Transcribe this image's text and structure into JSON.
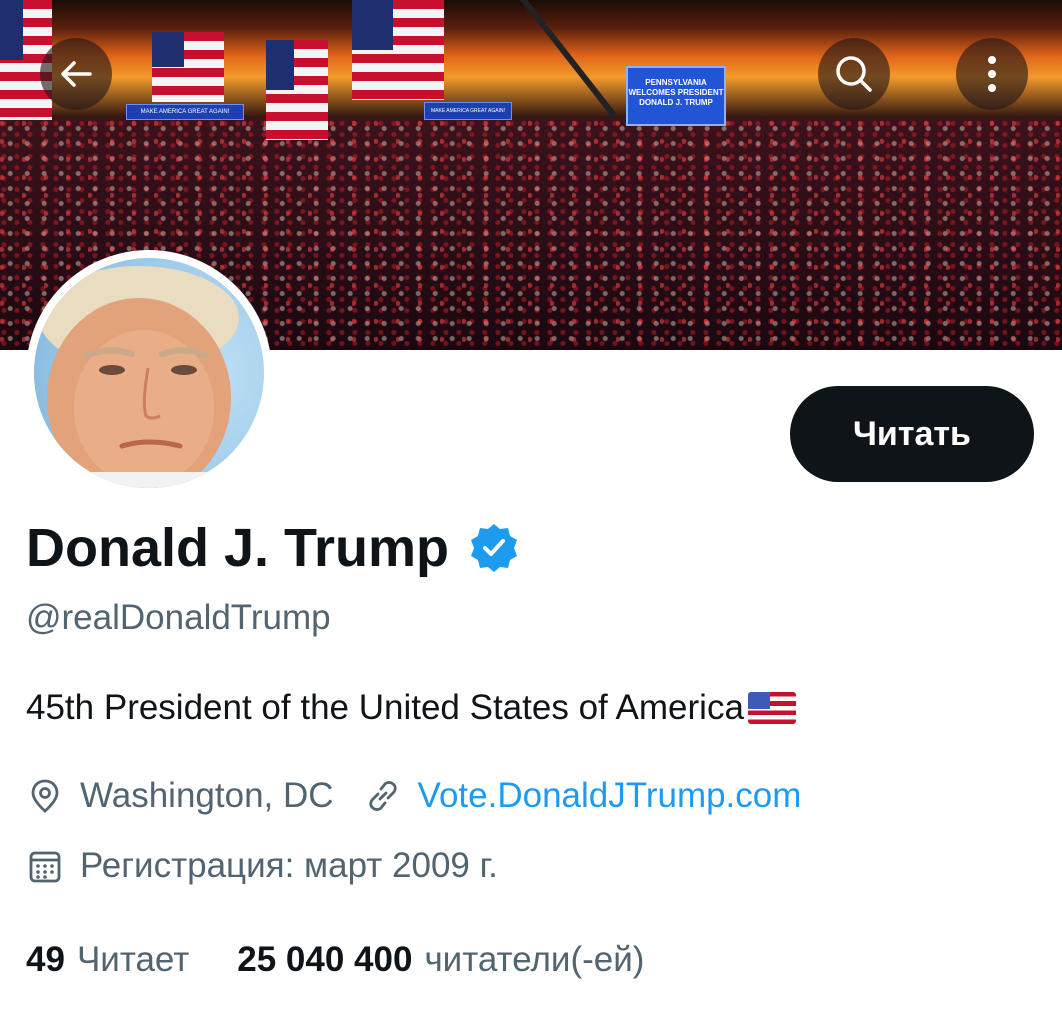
{
  "header": {
    "back_icon": "arrow-left-icon",
    "search_icon": "search-icon",
    "more_icon": "more-vertical-icon"
  },
  "profile": {
    "name": "Donald J. Trump",
    "handle": "@realDonaldTrump",
    "bio": "45th President of the United States of America",
    "bio_emoji": "us-flag-emoji",
    "location": "Washington, DC",
    "website": "Vote.DonaldJTrump.com",
    "joined": "Регистрация: март 2009 г.",
    "follow_label": "Читать",
    "verified_color": "#1d9bf0"
  },
  "stats": {
    "following_count": "49",
    "following_label": "Читает",
    "followers_count": "25 040 400",
    "followers_label": "читатели(-ей)"
  },
  "banner_text": {
    "jumbotron": "PENNSYLVANIA WELCOMES PRESIDENT DONALD J. TRUMP",
    "sign_left": "MAKE AMERICA GREAT AGAIN!",
    "sign_center": "MAKE AMERICA GREAT AGAIN!"
  },
  "colors": {
    "text_primary": "#0f1419",
    "text_secondary": "#536471",
    "link": "#1d9bf0",
    "follow_button_bg": "#0f1419"
  }
}
